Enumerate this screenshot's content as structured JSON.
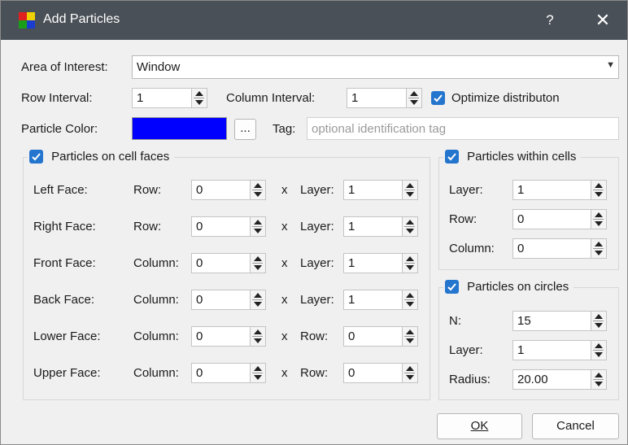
{
  "window": {
    "title": "Add Particles",
    "help_label": "?",
    "close_label": "✕",
    "app_icon": "particles-app-icon"
  },
  "top": {
    "area_label": "Area of Interest:",
    "area_value": "Window",
    "row_interval_label": "Row Interval:",
    "row_interval_value": "1",
    "column_interval_label": "Column Interval:",
    "column_interval_value": "1",
    "optimize_label": "Optimize distributon",
    "optimize_checked": true,
    "color_label": "Particle Color:",
    "color_value": "#0000ff",
    "browse_label": "...",
    "tag_label": "Tag:",
    "tag_placeholder": "optional identification tag",
    "tag_value": ""
  },
  "faces_group": {
    "title": "Particles on cell faces",
    "checked": true,
    "x_label": "x",
    "rows": [
      {
        "face": "Left Face:",
        "first_label": "Row:",
        "first_value": "0",
        "second_label": "Layer:",
        "second_value": "1"
      },
      {
        "face": "Right Face:",
        "first_label": "Row:",
        "first_value": "0",
        "second_label": "Layer:",
        "second_value": "1"
      },
      {
        "face": "Front Face:",
        "first_label": "Column:",
        "first_value": "0",
        "second_label": "Layer:",
        "second_value": "1"
      },
      {
        "face": "Back Face:",
        "first_label": "Column:",
        "first_value": "0",
        "second_label": "Layer:",
        "second_value": "1"
      },
      {
        "face": "Lower Face:",
        "first_label": "Column:",
        "first_value": "0",
        "second_label": "Row:",
        "second_value": "0"
      },
      {
        "face": "Upper Face:",
        "first_label": "Column:",
        "first_value": "0",
        "second_label": "Row:",
        "second_value": "0"
      }
    ]
  },
  "cells_group": {
    "title": "Particles within cells",
    "checked": true,
    "fields": [
      {
        "label": "Layer:",
        "value": "1"
      },
      {
        "label": "Row:",
        "value": "0"
      },
      {
        "label": "Column:",
        "value": "0"
      }
    ]
  },
  "circles_group": {
    "title": "Particles on circles",
    "checked": true,
    "fields": [
      {
        "label": "N:",
        "value": "15"
      },
      {
        "label": "Layer:",
        "value": "1"
      },
      {
        "label": "Radius:",
        "value": "20.00"
      }
    ]
  },
  "buttons": {
    "ok": "OK",
    "cancel": "Cancel"
  },
  "colors": {
    "accent": "#2475cd",
    "titlebar": "#4a5057"
  }
}
